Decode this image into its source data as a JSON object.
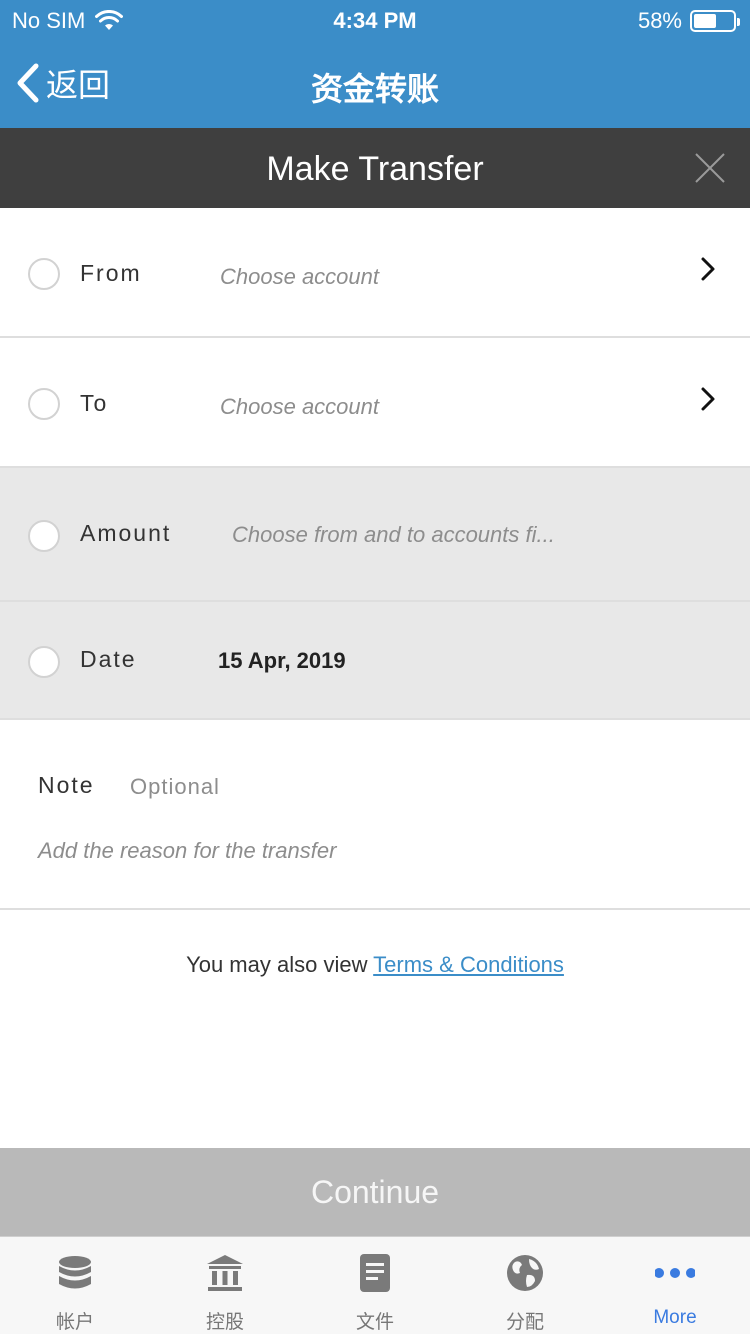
{
  "status_bar": {
    "carrier": "No SIM",
    "time": "4:34 PM",
    "battery_percent_label": "58%",
    "battery_level": 0.58
  },
  "nav": {
    "back_label": "返回",
    "title": "资金转账"
  },
  "modal": {
    "title": "Make Transfer"
  },
  "fields": {
    "from": {
      "label": "From",
      "placeholder": "Choose account"
    },
    "to": {
      "label": "To",
      "placeholder": "Choose account"
    },
    "amount": {
      "label": "Amount",
      "placeholder": "Choose from and to accounts fi..."
    },
    "date": {
      "label": "Date",
      "value": "15 Apr, 2019"
    }
  },
  "note": {
    "label": "Note",
    "optional": "Optional",
    "placeholder": "Add the reason for the transfer"
  },
  "terms": {
    "prefix": "You may also view ",
    "link": "Terms & Conditions"
  },
  "continue_label": "Continue",
  "tabs": [
    {
      "label": "帐户",
      "icon": "database-icon"
    },
    {
      "label": "控股",
      "icon": "bank-icon"
    },
    {
      "label": "文件",
      "icon": "document-icon"
    },
    {
      "label": "分配",
      "icon": "globe-icon"
    },
    {
      "label": "More",
      "icon": "more-dots-icon",
      "active": true
    }
  ],
  "colors": {
    "brand_blue": "#3b8dc8",
    "modal_header": "#3f3f3f",
    "disabled_button": "#b9b9b9",
    "active_tab": "#3a7be0"
  }
}
